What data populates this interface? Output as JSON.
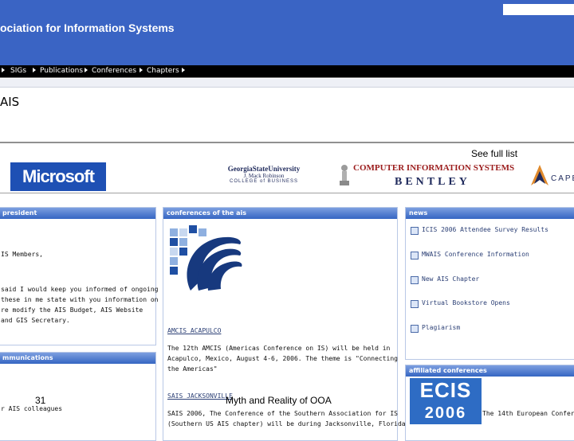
{
  "header": {
    "site_title": "ociation for Information Systems"
  },
  "nav": {
    "items": [
      "SIGs",
      "Publications",
      "Conferences",
      "Chapters"
    ]
  },
  "page": {
    "heading": "AIS",
    "see_full_list": "See full list"
  },
  "sponsors": {
    "microsoft": "Microsoft",
    "gsu_name": "GeorgiaStateUniversity",
    "gsu_school": "J. Mack Robinson",
    "gsu_college": "COLLEGE of BUSINESS",
    "bentley_program": "COMPUTER INFORMATION SYSTEMS",
    "bentley_name": "BENTLEY",
    "cape_name": "CAPE"
  },
  "president_panel": {
    "title": "president",
    "lines": [
      "IS Members,",
      "said I would keep you informed of ongoing",
      "these in me state with you information on",
      "re modify the AIS Budget, AIS Website",
      "and GIS Secretary."
    ]
  },
  "communications_panel": {
    "title": "mmunications",
    "line": "r AIS colleagues"
  },
  "conferences_panel": {
    "title": "conferences of the ais",
    "amcis_link": "AMCIS ACAPULCO",
    "amcis_lines": [
      "The 12th AMCIS (Americas Conference on IS) will be held in",
      "Acapulco, Mexico, August 4-6, 2006. The theme is \"Connecting",
      "the Americas\""
    ],
    "sais_link": "SAIS JACKSONVILLE",
    "sais_lines": [
      "SAIS 2006, The Conference of the Southern Association for IS",
      "(Southern US AIS chapter) will be during Jacksonville, Florida,"
    ]
  },
  "news_panel": {
    "title": "news",
    "items": [
      "ICIS 2006 Attendee Survey Results",
      "MWAIS Conference Information",
      "New AIS Chapter",
      "Virtual Bookstore Opens",
      "Plagiarism"
    ]
  },
  "affiliated_panel": {
    "title": "affiliated conferences",
    "ecis_top": "ECIS",
    "ecis_year": "2006",
    "line": "The 14th European Confere"
  },
  "slide": {
    "number": "31",
    "title": "Myth and Reality of OOA"
  },
  "colors": {
    "banner": "#3a64c4",
    "panel_header": "#3566c2",
    "link": "#2b3f75"
  }
}
